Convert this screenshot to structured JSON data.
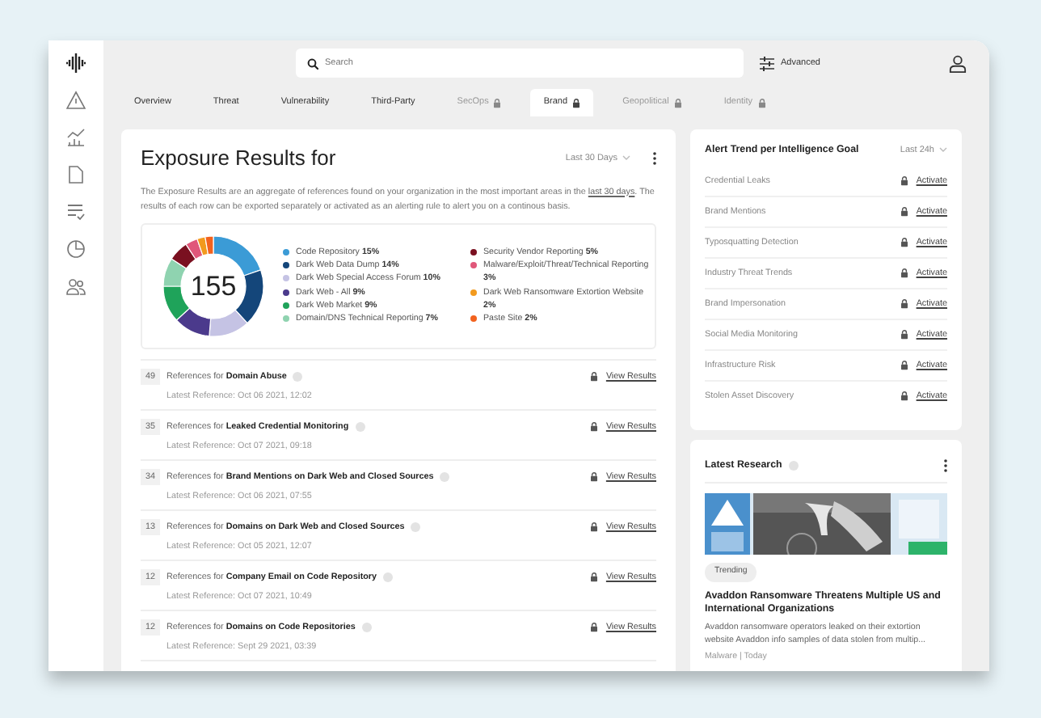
{
  "sidebar": {
    "items": [
      {
        "kind": "logo"
      },
      {
        "kind": "warning"
      },
      {
        "kind": "chart"
      },
      {
        "kind": "document"
      },
      {
        "kind": "tasks"
      },
      {
        "kind": "pie"
      },
      {
        "kind": "users"
      }
    ]
  },
  "search": {
    "placeholder": "Search"
  },
  "advanced": "Advanced",
  "tabs": [
    {
      "label": "Overview",
      "selected": false,
      "locked": false
    },
    {
      "label": "Threat",
      "selected": false,
      "locked": false
    },
    {
      "label": "Vulnerability",
      "selected": false,
      "locked": false
    },
    {
      "label": "Third-Party",
      "selected": false,
      "locked": false
    },
    {
      "label": "SecOps",
      "selected": false,
      "locked": true
    },
    {
      "label": "Brand",
      "selected": true,
      "locked": true
    },
    {
      "label": "Geopolitical",
      "selected": false,
      "locked": true
    },
    {
      "label": "Identity",
      "selected": false,
      "locked": true
    }
  ],
  "exposure": {
    "title": "Exposure Results for",
    "period": "Last 30 Days",
    "description": "The Exposure Results are an aggregate of references found on your organization in the most important areas in the ",
    "description_link": "last 30 days",
    "description_end": ". The results of each row can be exported separately or activated as an alerting rule to alert you on a continous basis.",
    "total": "155",
    "chart_data": {
      "type": "donut",
      "legend": "right",
      "categories": [
        "Code Repository",
        "Dark Web Data Dump",
        "Dark Web Special Access Forum",
        "Dark Web - All",
        "Dark Web Market",
        "Domain/DNS Technical Reporting",
        "Security Vendor Reporting",
        "Malware/Exploit/Threat/Technical Reporting",
        "Dark Web Ransomware Extortion Website",
        "Paste Site"
      ],
      "values": [
        15,
        14,
        10,
        9,
        9,
        7,
        5,
        3,
        2,
        2
      ],
      "value_labels": [
        "15%",
        "14%",
        "10%",
        "9%",
        "9%",
        "7%",
        "5%",
        "3%",
        "2%",
        "2%"
      ],
      "colors": [
        "#3b9bd6",
        "#14467a",
        "#c5c3e4",
        "#4b3a8c",
        "#1fa35a",
        "#8fd3b0",
        "#7a1020",
        "#e0577a",
        "#f29a1e",
        "#f2621e"
      ]
    },
    "rows": [
      {
        "count": "49",
        "text": "References for **Domain Abuse**",
        "latest": "Latest Reference: Oct 06 2021, 12:02",
        "action": "View Results"
      },
      {
        "count": "35",
        "text": "References for **Leaked Credential Monitoring**",
        "latest": "Latest Reference: Oct 07 2021, 09:18",
        "action": "View Results"
      },
      {
        "count": "34",
        "text": "References for **Brand Mentions on Dark Web and Closed Sources**",
        "latest": "Latest Reference: Oct 06 2021, 07:55",
        "action": "View Results"
      },
      {
        "count": "13",
        "text": "References for **Domains on Dark Web and Closed Sources**",
        "latest": "Latest Reference: Oct 05 2021, 12:07",
        "action": "View Results"
      },
      {
        "count": "12",
        "text": "References for **Company Email on Code Repository**",
        "latest": "Latest Reference: Oct 07 2021, 10:49",
        "action": "View Results"
      },
      {
        "count": "12",
        "text": "References for **Domains on Code Repositories**",
        "latest": "Latest Reference: Sept 29 2021, 03:39",
        "action": "View Results"
      }
    ]
  },
  "alerts": {
    "title": "Alert Trend per Intelligence Goal",
    "period": "Last 24h",
    "rows": [
      {
        "label": "Credential Leaks",
        "action": "Activate"
      },
      {
        "label": "Brand Mentions",
        "action": "Activate"
      },
      {
        "label": "Typosquatting Detection",
        "action": "Activate"
      },
      {
        "label": "Industry Threat Trends",
        "action": "Activate"
      },
      {
        "label": "Brand Impersonation",
        "action": "Activate"
      },
      {
        "label": "Social Media Monitoring",
        "action": "Activate"
      },
      {
        "label": "Infrastructure Risk",
        "action": "Activate"
      },
      {
        "label": "Stolen Asset Discovery",
        "action": "Activate"
      }
    ]
  },
  "research": {
    "title": "Latest Research",
    "tag": "Trending",
    "headline": "Avaddon Ransomware Threatens Multiple US and International Organizations",
    "summary": "Avaddon ransomware operators leaked on their extortion website Avaddon info samples of data stolen from multip...",
    "meta": "Malware | Today"
  }
}
